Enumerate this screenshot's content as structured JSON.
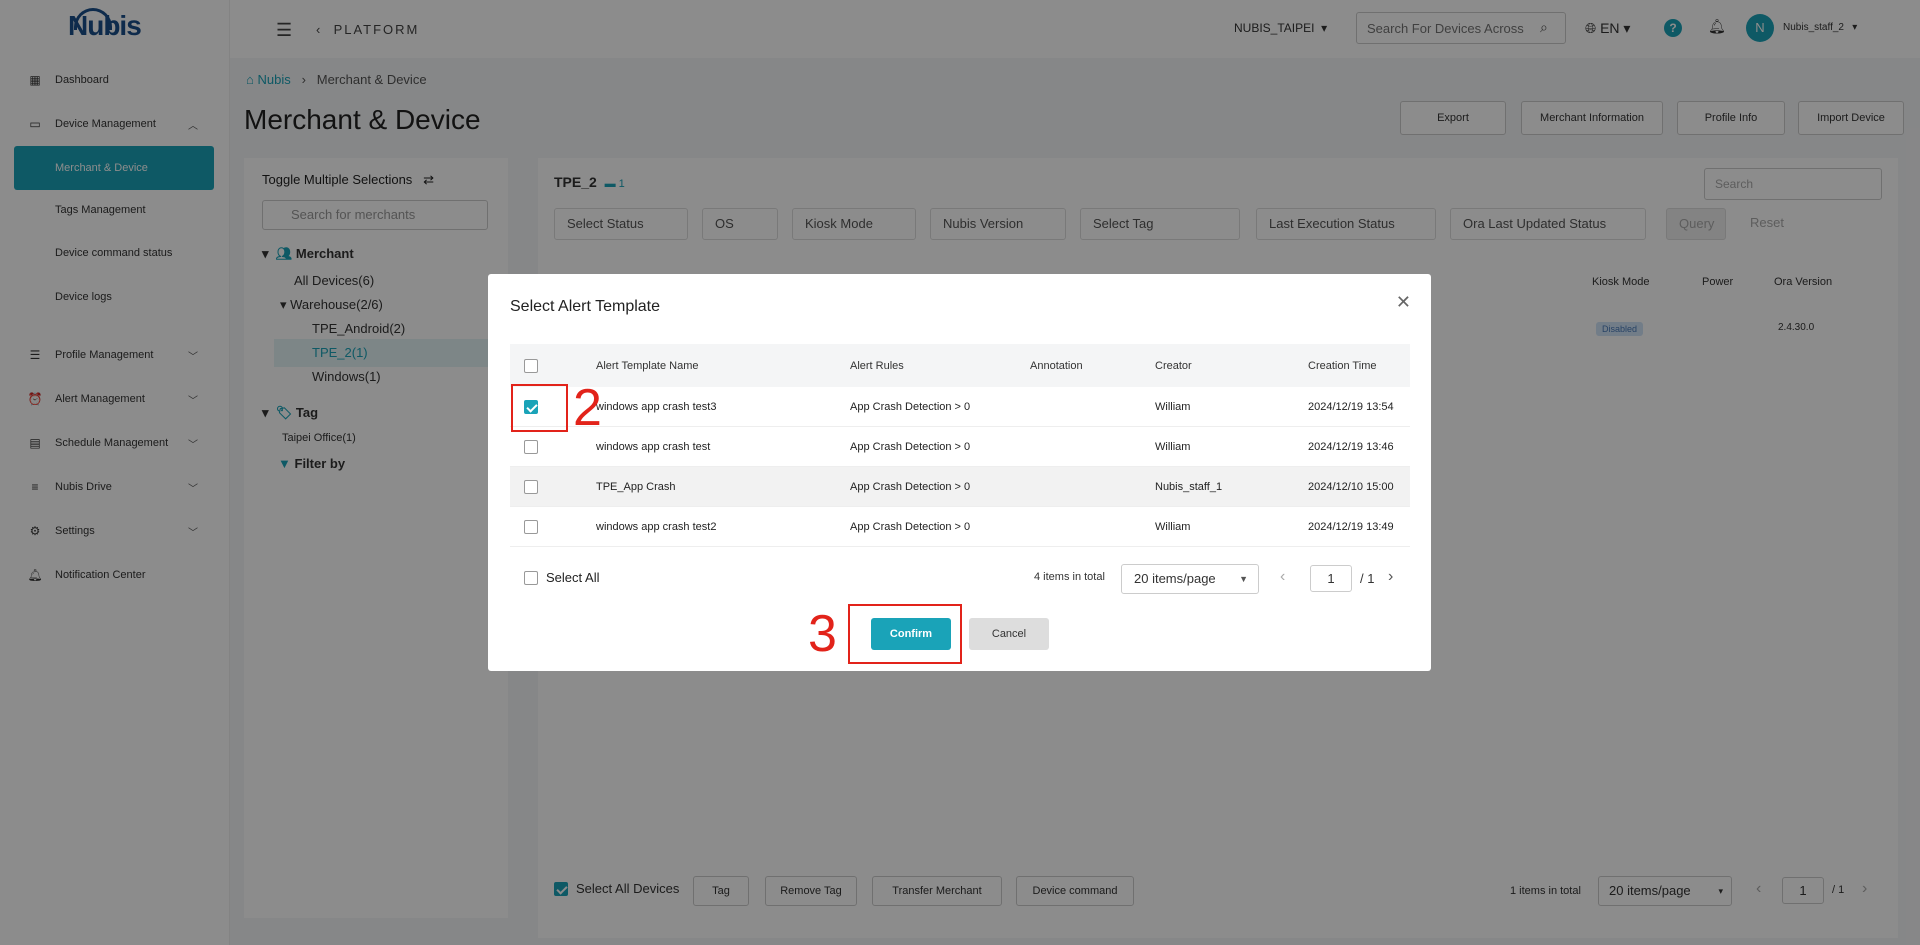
{
  "sidebar": {
    "logo": "Nubis",
    "items": [
      {
        "label": "Dashboard",
        "icon": "dashboard-icon"
      },
      {
        "label": "Device Management",
        "icon": "device-icon",
        "expanded": true,
        "children": [
          "Merchant & Device",
          "Tags Management",
          "Device command status",
          "Device logs"
        ]
      },
      {
        "label": "Profile Management",
        "icon": "profile-icon"
      },
      {
        "label": "Alert Management",
        "icon": "alarm-icon"
      },
      {
        "label": "Schedule Management",
        "icon": "calendar-icon"
      },
      {
        "label": "Nubis Drive",
        "icon": "drive-icon"
      },
      {
        "label": "Settings",
        "icon": "settings-icon"
      },
      {
        "label": "Notification Center",
        "icon": "bell-icon"
      }
    ],
    "active_child": "Merchant & Device"
  },
  "topbar": {
    "platform": "PLATFORM",
    "tenant": "NUBIS_TAIPEI",
    "search_placeholder": "Search For Devices Across",
    "lang": "EN",
    "help": "?",
    "avatar_letter": "N",
    "username": "Nubis_staff_2"
  },
  "page": {
    "breadcrumb_home": "Nubis",
    "breadcrumb_current": "Merchant & Device",
    "title": "Merchant & Device",
    "buttons": [
      "Export",
      "Merchant Information",
      "Profile Info",
      "Import Device"
    ]
  },
  "left_panel": {
    "toggle": "Toggle Multiple Selections",
    "search_placeholder": "Search for merchants",
    "merchant_label": "Merchant",
    "all_devices": "All Devices(6)",
    "warehouse": "Warehouse(2/6)",
    "tpe_android": "TPE_Android(2)",
    "tpe_2": "TPE_2(1)",
    "windows": "Windows(1)",
    "tag_label": "Tag",
    "taipei_office": "Taipei Office(1)",
    "filter_by": "Filter by"
  },
  "right_panel": {
    "group_title": "TPE_2",
    "group_count": "1",
    "search_placeholder": "Search",
    "filters": [
      "Select Status",
      "OS",
      "Kiosk Mode",
      "Nubis Version",
      "Select Tag",
      "Last Execution Status",
      "Ora Last Updated Status"
    ],
    "query": "Query",
    "reset": "Reset",
    "col_kiosk": "Kiosk Mode",
    "col_power": "Power",
    "col_ora": "Ora Version",
    "row_kiosk": "Disabled",
    "row_ora": "2.4.30.0"
  },
  "bottom_bar": {
    "select_all_devices": "Select All Devices",
    "buttons": [
      "Tag",
      "Remove Tag",
      "Transfer Merchant",
      "Device command"
    ],
    "items_total": "1 items in total",
    "page_size": "20 items/page",
    "page": "1",
    "pages": "/ 1"
  },
  "modal": {
    "title": "Select Alert Template",
    "columns": [
      "Alert Template Name",
      "Alert Rules",
      "Annotation",
      "Creator",
      "Creation Time"
    ],
    "rows": [
      {
        "name": "windows app crash test3",
        "rules": "App Crash Detection > 0",
        "annotation": "",
        "creator": "William",
        "time": "2024/12/19 13:54",
        "checked": true
      },
      {
        "name": "windows app crash test",
        "rules": "App Crash Detection > 0",
        "annotation": "",
        "creator": "William",
        "time": "2024/12/19 13:46",
        "checked": false
      },
      {
        "name": "TPE_App Crash",
        "rules": "App Crash Detection > 0",
        "annotation": "",
        "creator": "Nubis_staff_1",
        "time": "2024/12/10 15:00",
        "checked": false
      },
      {
        "name": "windows app crash test2",
        "rules": "App Crash Detection > 0",
        "annotation": "",
        "creator": "William",
        "time": "2024/12/19 13:49",
        "checked": false
      }
    ],
    "select_all": "Select All",
    "items_total": "4 items in total",
    "page_size": "20 items/page",
    "page": "1",
    "pages": "/ 1",
    "confirm": "Confirm",
    "cancel": "Cancel"
  },
  "annotations": {
    "step2": "2",
    "step3": "3",
    "color": "#e2231a"
  },
  "colors": {
    "accent": "#1aa3b8",
    "brand": "#1a4f8a"
  }
}
